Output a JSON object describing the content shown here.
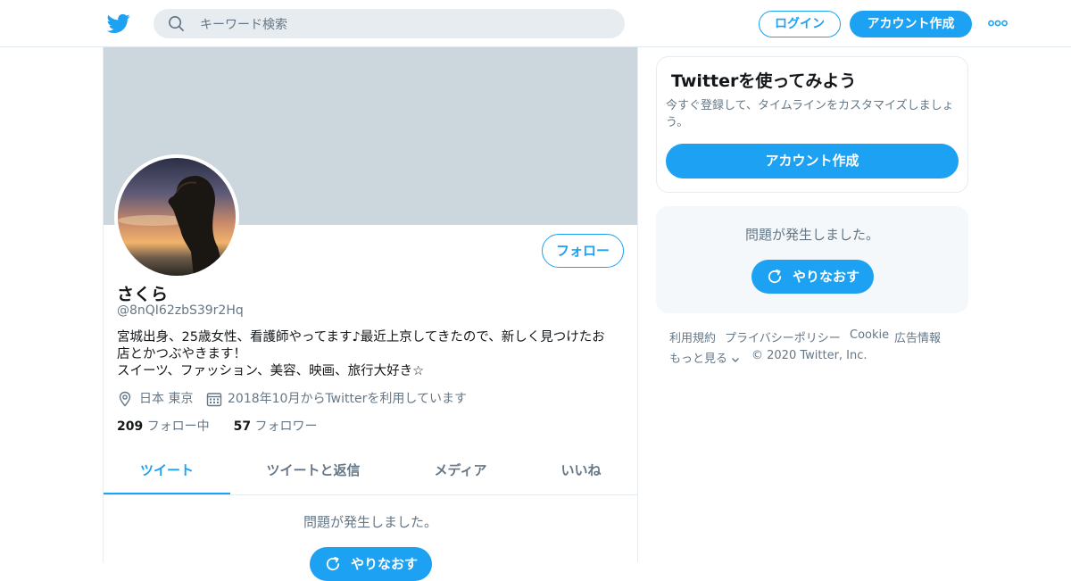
{
  "header": {
    "search_placeholder": "キーワード検索",
    "login_label": "ログイン",
    "signup_label": "アカウント作成"
  },
  "profile": {
    "display_name": "さくら",
    "handle": "@8nQI62zbS39r2Hq",
    "follow_label": "フォロー",
    "bio_lines": [
      "宮城出身、25歳女性、看護師やってます♪最近上京してきたので、新しく見つけたお",
      "店とかつぶやきます！",
      "スイーツ、ファッション、美容、映画、旅行大好き☆"
    ],
    "location": "日本 東京",
    "joined": "2018年10月からTwitterを利用しています",
    "following_count": "209",
    "following_label": "フォロー中",
    "followers_count": "57",
    "followers_label": "フォロワー",
    "tabs": [
      {
        "label": "ツイート",
        "active": true
      },
      {
        "label": "ツイートと返信",
        "active": false
      },
      {
        "label": "メディア",
        "active": false
      },
      {
        "label": "いいね",
        "active": false
      }
    ],
    "problem_text": "問題が発生しました。",
    "retry_label": "やりなおす"
  },
  "sidebar": {
    "signup_card": {
      "title": "Twitterを使ってみよう",
      "description": "今すぐ登録して、タイムラインをカスタマイズしましょう。",
      "button_label": "アカウント作成"
    },
    "problem_card": {
      "text": "問題が発生しました。",
      "retry_label": "やりなおす"
    },
    "footer": {
      "links": [
        "利用規約",
        "プライバシーポリシー",
        "Cookie",
        "広告情報"
      ],
      "more_label": "もっと見る",
      "copyright": "© 2020 Twitter, Inc."
    }
  },
  "colors": {
    "accent": "#1da1f2",
    "banner": "#ccd6dd",
    "secondary_text": "#657786",
    "panel_bg": "#f5f8fa"
  },
  "icons": [
    "twitter-bird-icon",
    "search-icon",
    "more-icon",
    "location-icon",
    "calendar-icon",
    "refresh-icon",
    "chevron-down-icon"
  ]
}
